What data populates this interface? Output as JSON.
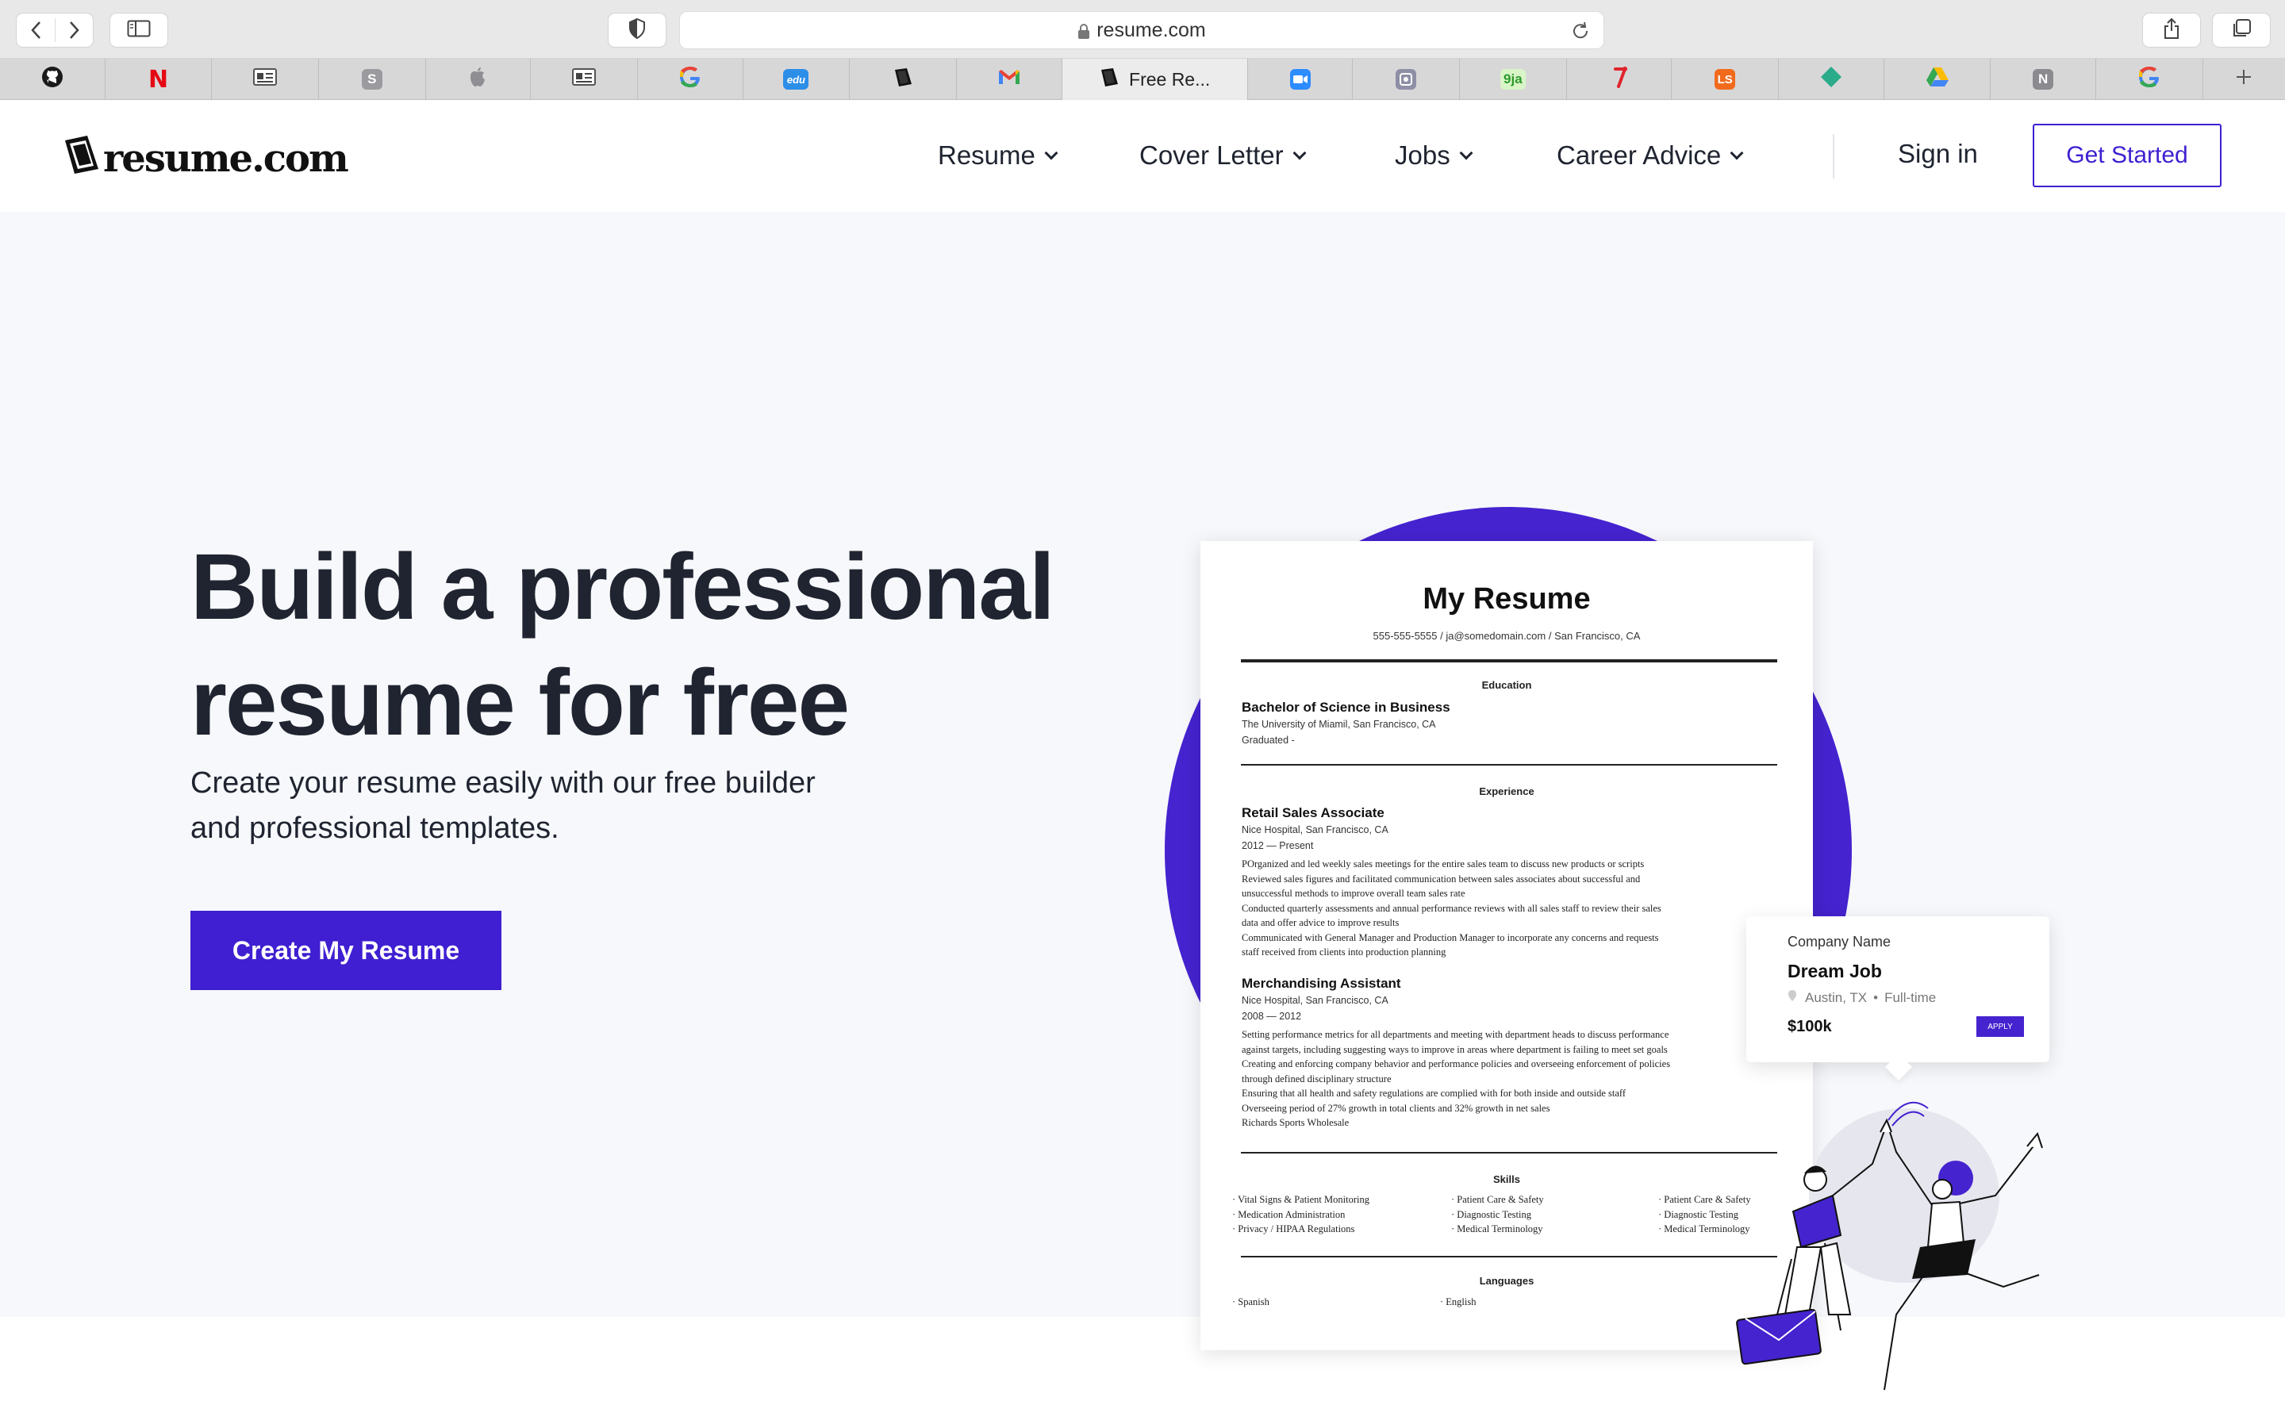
{
  "browser": {
    "url": "resume.com",
    "tabs": [
      {
        "icon": "github-icon",
        "label": ""
      },
      {
        "icon": "netflix-icon",
        "label": ""
      },
      {
        "icon": "reader-icon",
        "label": ""
      },
      {
        "icon": "s-app-icon",
        "label": ""
      },
      {
        "icon": "apple-icon",
        "label": ""
      },
      {
        "icon": "reader-icon",
        "label": ""
      },
      {
        "icon": "google-icon",
        "label": ""
      },
      {
        "icon": "edu-icon",
        "label": ""
      },
      {
        "icon": "resume-logo-icon",
        "label": ""
      },
      {
        "icon": "gmail-icon",
        "label": ""
      },
      {
        "icon": "resume-logo-icon",
        "label": "Free Re..."
      },
      {
        "icon": "zoom-icon",
        "label": ""
      },
      {
        "icon": "screen-icon",
        "label": ""
      },
      {
        "icon": "9ja-icon",
        "label": ""
      },
      {
        "icon": "red-icon",
        "label": ""
      },
      {
        "icon": "ls-icon",
        "label": ""
      },
      {
        "icon": "diamond-icon",
        "label": ""
      },
      {
        "icon": "drive-icon",
        "label": ""
      },
      {
        "icon": "notion-icon",
        "label": ""
      },
      {
        "icon": "google-icon",
        "label": ""
      }
    ],
    "fav_texts": {
      "s": "S",
      "edu": "edu",
      "ja": "9ja",
      "ls": "LS",
      "n": "N",
      "netflix": "N"
    }
  },
  "header": {
    "logo_text": "resume.com",
    "nav": [
      "Resume",
      "Cover Letter",
      "Jobs",
      "Career Advice"
    ],
    "signin": "Sign in",
    "get_started": "Get Started"
  },
  "hero": {
    "title_line1": "Build a professional",
    "title_line2": "resume for free",
    "subtitle_line1": "Create your resume easily with our free builder",
    "subtitle_line2": "and professional templates.",
    "cta": "Create My Resume"
  },
  "resume": {
    "title": "My Resume",
    "contact": "555-555-5555 / ja@somedomain.com / San Francisco, CA",
    "education_heading": "Education",
    "degree": "Bachelor of Science in Business",
    "school": "The University of Miamil, San Francisco, CA",
    "graduated": "Graduated -",
    "experience_heading": "Experience",
    "job1": {
      "role": "Retail Sales Associate",
      "place": "Nice Hospital, San Francisco, CA",
      "dates": "2012 — Present",
      "bullets": [
        "POrganized and led weekly sales meetings for the entire sales team to discuss new products or scripts",
        "Reviewed sales figures and facilitated communication between sales associates about successful and",
        "unsuccessful methods to improve overall team sales rate",
        "Conducted quarterly assessments and annual performance reviews with all sales staff to review their sales",
        "data and offer advice to improve results",
        "Communicated with General Manager and Production Manager to incorporate any concerns and requests",
        "staff received from clients into production planning"
      ]
    },
    "job2": {
      "role": "Merchandising Assistant",
      "place": "Nice Hospital, San Francisco, CA",
      "dates": "2008 — 2012",
      "bullets": [
        "Setting performance metrics for all departments and meeting with department heads to discuss performance",
        "against targets, including suggesting ways to improve in areas where department is failing to meet set goals",
        "Creating and enforcing company behavior and performance policies and overseeing enforcement of policies",
        "through defined disciplinary structure",
        "Ensuring that all health and safety regulations are complied with for both inside and outside staff",
        "Overseeing period of 27% growth in total clients and 32% growth in net sales",
        "Richards Sports Wholesale"
      ]
    },
    "skills_heading": "Skills",
    "skills_col1": [
      "Vital Signs & Patient Monitoring",
      "Medication Administration",
      "Privacy / HIPAA Regulations"
    ],
    "skills_col2": [
      "Patient Care & Safety",
      "Diagnostic Testing",
      "Medical Terminology"
    ],
    "skills_col3": [
      "Patient Care & Safety",
      "Diagnostic Testing",
      "Medical Terminology"
    ],
    "languages_heading": "Languages",
    "languages": [
      "Spanish",
      "English"
    ]
  },
  "job_card": {
    "company": "Company Name",
    "title": "Dream Job",
    "location": "Austin, TX",
    "type": "Full-time",
    "salary": "$100k",
    "apply": "APPLY"
  },
  "colors": {
    "brand": "#3f1fd1",
    "hero_bg": "#f7f8fb",
    "accent_circle": "#4523cf"
  }
}
